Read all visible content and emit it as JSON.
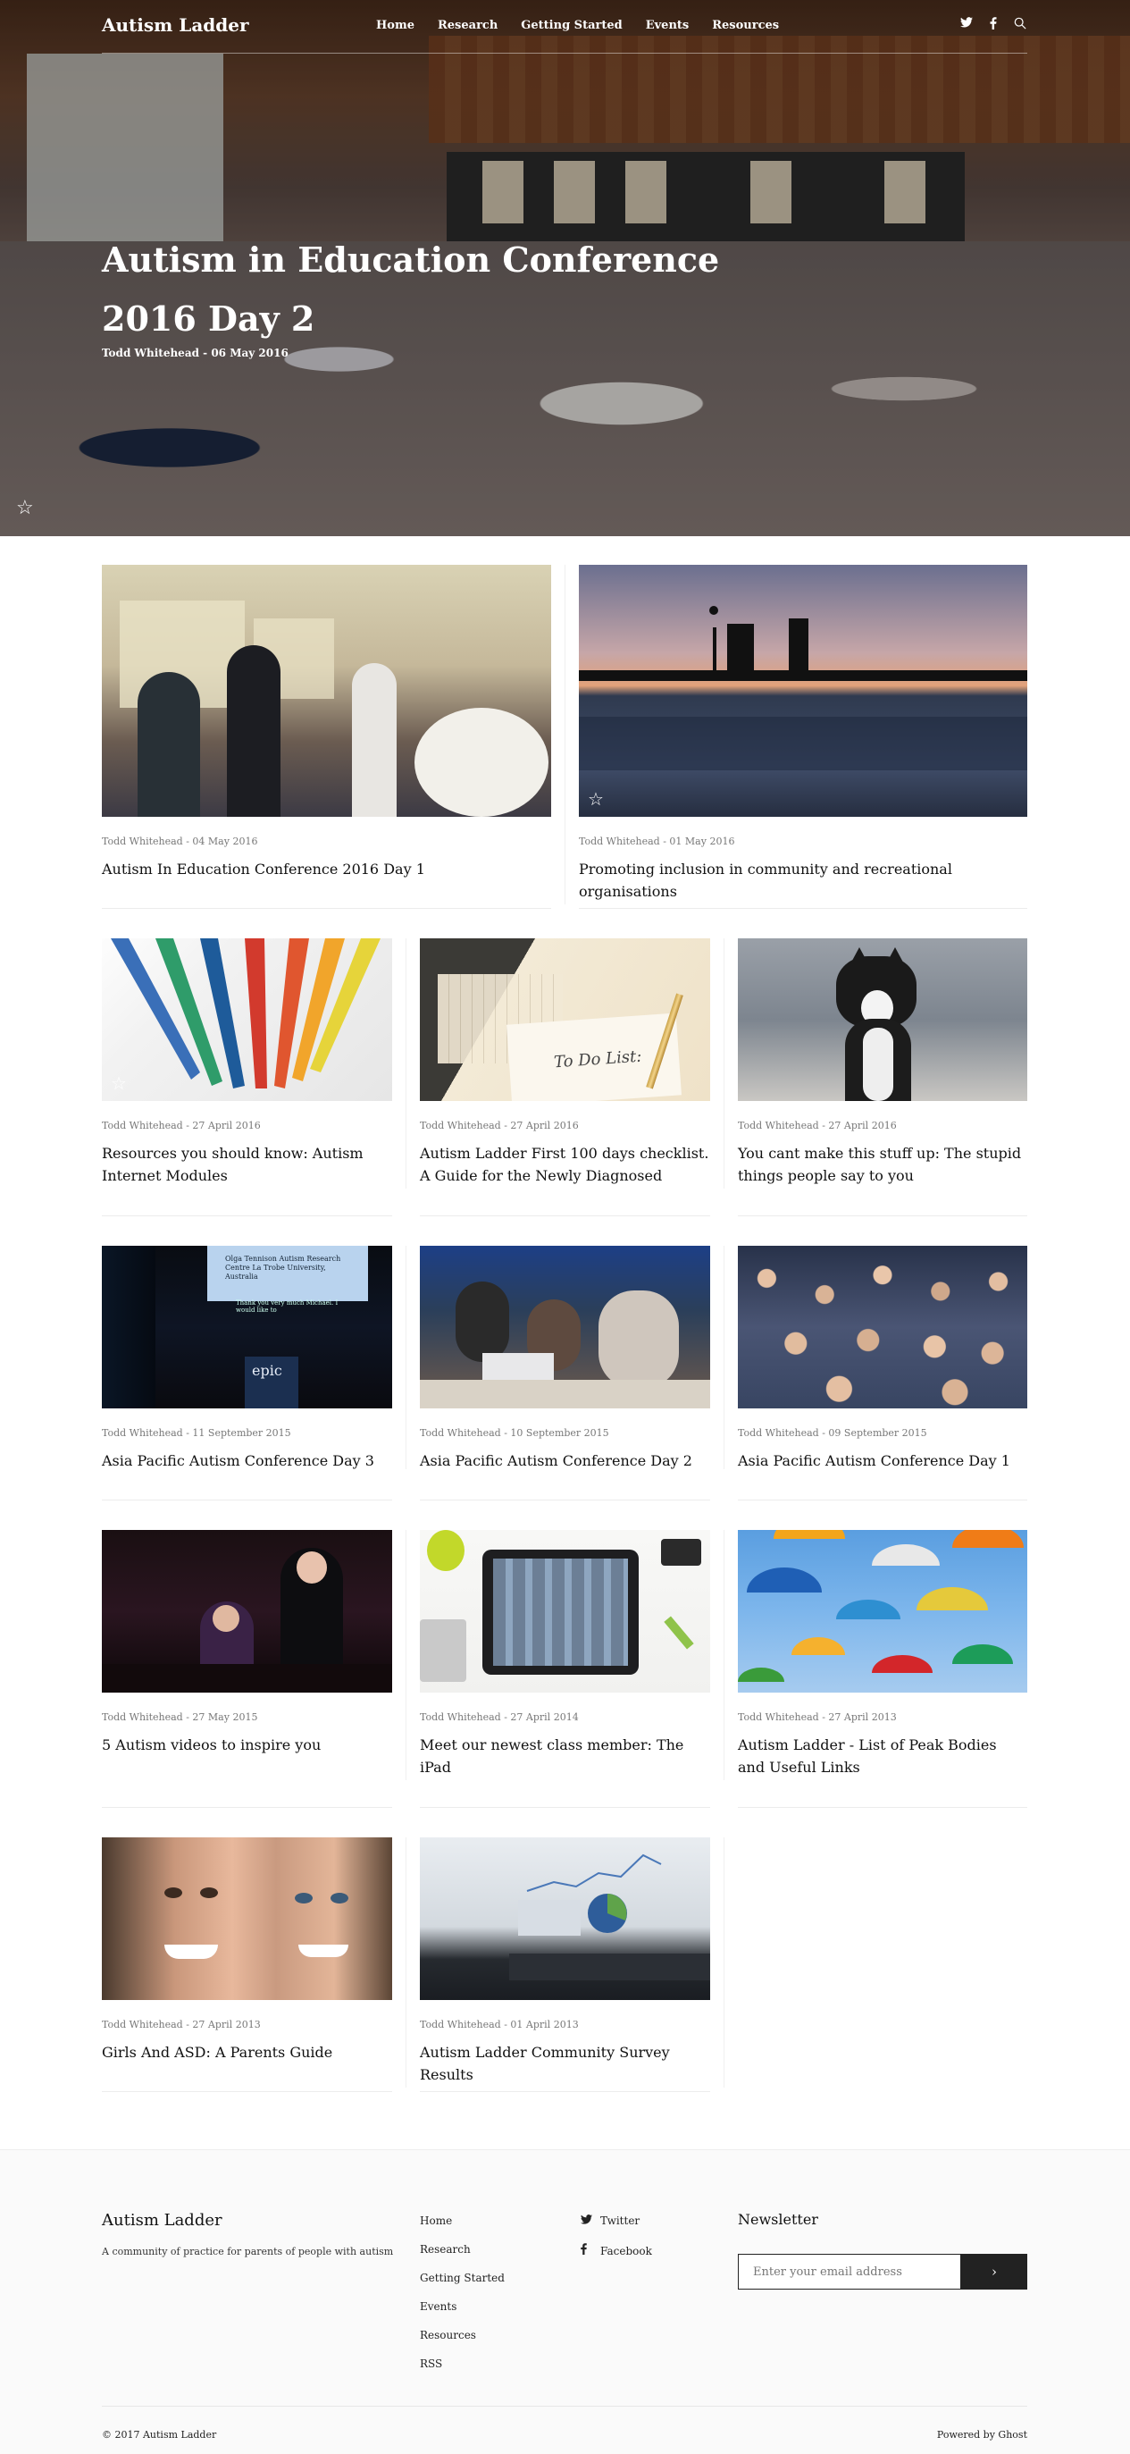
{
  "header": {
    "brand": "Autism Ladder",
    "menu": [
      "Home",
      "Research",
      "Getting Started",
      "Events",
      "Resources"
    ],
    "icons": [
      "twitter-icon",
      "facebook-icon",
      "search-icon"
    ]
  },
  "hero": {
    "title": "Autism in Education Conference 2016 Day 2",
    "meta": "Todd Whitehead - 06 May 2016"
  },
  "posts": [
    {
      "meta": "Todd Whitehead - 04 May 2016",
      "title": "Autism In Education Conference 2016 Day 1"
    },
    {
      "meta": "Todd Whitehead - 01 May 2016",
      "title": "Promoting inclusion in community and recreational organisations"
    },
    {
      "meta": "Todd Whitehead - 27 April 2016",
      "title": "Resources you should know: Autism Internet Modules"
    },
    {
      "meta": "Todd Whitehead - 27 April 2016",
      "title": "Autism Ladder First 100 days checklist. A Guide for the Newly Diagnosed"
    },
    {
      "meta": "Todd Whitehead - 27 April 2016",
      "title": "You cant make this stuff up: The stupid things people say to you"
    },
    {
      "meta": "Todd Whitehead - 11 September 2015",
      "title": "Asia Pacific Autism Conference Day 3"
    },
    {
      "meta": "Todd Whitehead - 10 September 2015",
      "title": "Asia Pacific Autism Conference Day 2"
    },
    {
      "meta": "Todd Whitehead - 09 September 2015",
      "title": "Asia Pacific Autism Conference Day 1"
    },
    {
      "meta": "Todd Whitehead - 27 May 2015",
      "title": "5 Autism videos to inspire you"
    },
    {
      "meta": "Todd Whitehead - 27 April 2014",
      "title": "Meet our newest class member: The iPad"
    },
    {
      "meta": "Todd Whitehead - 27 April 2013",
      "title": "Autism Ladder - List of Peak Bodies and Useful Links"
    },
    {
      "meta": "Todd Whitehead - 27 April 2013",
      "title": "Girls And ASD: A Parents Guide"
    },
    {
      "meta": "Todd Whitehead - 01 April 2013",
      "title": "Autism Ladder Community Survey Results"
    }
  ],
  "thumb_text": {
    "todo": "To Do List:",
    "slide": "Olga Tennison Autism Research Centre La Trobe University, Australia",
    "slide2": "Thank you very much Michael. I would like to",
    "epic": "epic"
  },
  "footer": {
    "brand": "Autism Ladder",
    "description": "A community of practice for parents of people with autism",
    "links": [
      "Home",
      "Research",
      "Getting Started",
      "Events",
      "Resources",
      "RSS"
    ],
    "social": [
      "Twitter",
      "Facebook"
    ],
    "newsletter_title": "Newsletter",
    "email_placeholder": "Enter your email address",
    "submit_label": "›",
    "copyright": "© 2017 Autism Ladder",
    "powered": "Powered by Ghost"
  }
}
